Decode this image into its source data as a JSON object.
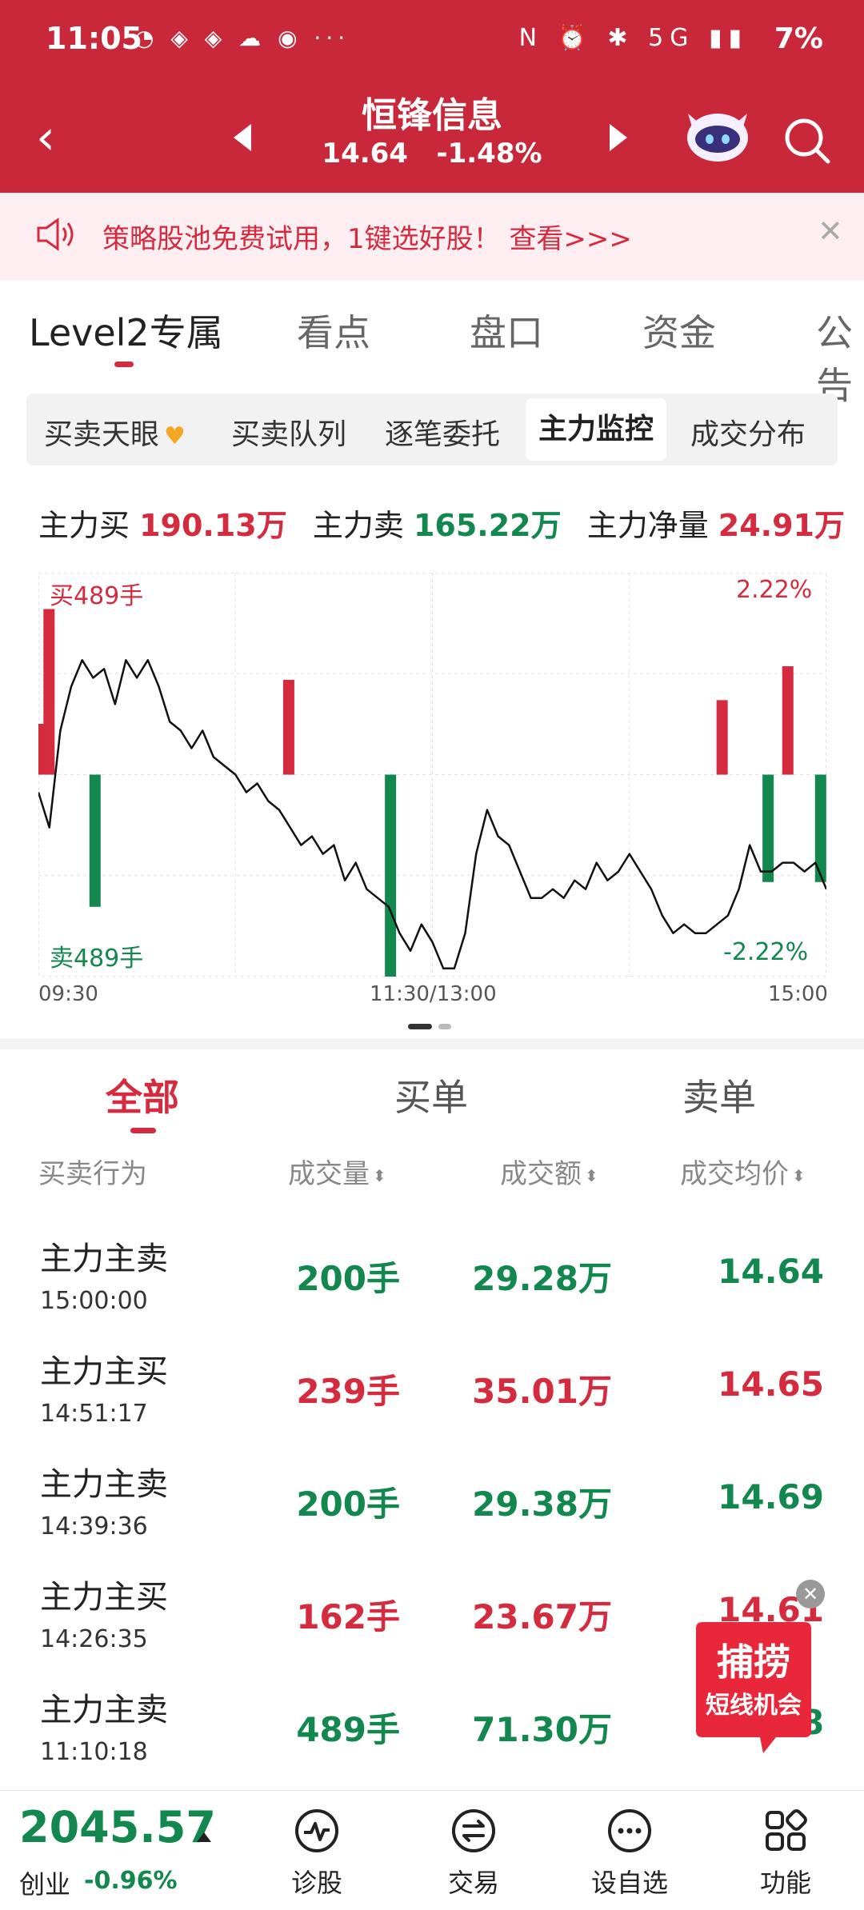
{
  "status_bar": {
    "time": "11:05",
    "notif_icons": "◔ ◈ ◈ ☁ ◉ ···",
    "right_icons": "N ⏰ ✱ 5G ▮▮",
    "battery": "7%"
  },
  "header": {
    "stock_name": "恒锋信息",
    "price": "14.64",
    "change": "-1.48%"
  },
  "promo": {
    "text": "策略股池免费试用，1键选好股！ 查看>>>"
  },
  "tabs": [
    "Level2专属",
    "看点",
    "盘口",
    "资金",
    "公告"
  ],
  "sub_tabs": [
    "买卖天眼",
    "买卖队列",
    "逐笔委托",
    "主力监控",
    "成交分布"
  ],
  "summary": {
    "buy_label": "主力买",
    "buy_value": "190.13万",
    "sell_label": "主力卖",
    "sell_value": "165.22万",
    "net_label": "主力净量",
    "net_value": "24.91万"
  },
  "chart_data": {
    "type": "line",
    "buy_max_label": "买489手",
    "sell_max_label": "卖489手",
    "pct_high": "2.22%",
    "pct_low": "-2.22%",
    "ylim_pct": [
      -2.22,
      2.22
    ],
    "x_labels": [
      "09:30",
      "11:30/13:00",
      "15:00"
    ],
    "series": [
      {
        "values": [
          -0.2,
          -0.6,
          0.5,
          1.0,
          1.3,
          1.1,
          1.2,
          0.8,
          1.3,
          1.1,
          1.3,
          1.0,
          0.6,
          0.5,
          0.3,
          0.5,
          0.2,
          0.1,
          0.0,
          -0.2,
          -0.1,
          -0.3,
          -0.4,
          -0.6,
          -0.8,
          -0.7,
          -0.9,
          -0.8,
          -1.2,
          -1.0,
          -1.3,
          -1.4,
          -1.5,
          -1.8,
          -2.0,
          -1.7,
          -1.9,
          -2.2,
          -2.2,
          -1.8,
          -0.9,
          -0.4,
          -0.7,
          -0.8,
          -1.1,
          -1.4,
          -1.4,
          -1.3,
          -1.4,
          -1.2,
          -1.3,
          -1.0,
          -1.2,
          -1.1,
          -0.9,
          -1.1,
          -1.3,
          -1.6,
          -1.8,
          -1.7,
          -1.8,
          -1.8,
          -1.7,
          -1.6,
          -1.3,
          -0.8,
          -1.1,
          -1.1,
          -1.0,
          -1.0,
          -1.1,
          -1.0,
          -1.3
        ]
      }
    ],
    "buy_bars": [
      {
        "t": 0.3,
        "hands": 150
      },
      {
        "t": 3,
        "hands": 489
      },
      {
        "t": 76,
        "hands": 280
      },
      {
        "t": 208,
        "hands": 220
      },
      {
        "t": 228,
        "hands": 320
      }
    ],
    "sell_bars": [
      {
        "t": 17,
        "hands": 320
      },
      {
        "t": 107,
        "hands": 489
      },
      {
        "t": 222,
        "hands": 260
      },
      {
        "t": 238,
        "hands": 260
      }
    ],
    "x_range": [
      0,
      240
    ]
  },
  "flow_tabs": [
    "全部",
    "买单",
    "卖单"
  ],
  "columns": [
    "买卖行为",
    "成交量",
    "成交额",
    "成交均价"
  ],
  "rows": [
    {
      "action": "主力主卖",
      "time": "15:00:00",
      "volume": "200手",
      "amount": "29.28万",
      "avg_price": "14.64",
      "side": "sell"
    },
    {
      "action": "主力主买",
      "time": "14:51:17",
      "volume": "239手",
      "amount": "35.01万",
      "avg_price": "14.65",
      "side": "buy"
    },
    {
      "action": "主力主卖",
      "time": "14:39:36",
      "volume": "200手",
      "amount": "29.38万",
      "avg_price": "14.69",
      "side": "sell"
    },
    {
      "action": "主力主买",
      "time": "14:26:35",
      "volume": "162手",
      "amount": "23.67万",
      "avg_price": "14.61",
      "side": "buy"
    },
    {
      "action": "主力主卖",
      "time": "11:10:18",
      "volume": "489手",
      "amount": "71.30万",
      "avg_price": "14.58",
      "side": "sell"
    }
  ],
  "float_ad": {
    "line1": "捕捞",
    "line2": "短线机会"
  },
  "bottom": {
    "index_value": "2045.57",
    "index_name": "创业",
    "index_change": "-0.96%",
    "nav": [
      "诊股",
      "交易",
      "设自选",
      "功能"
    ]
  },
  "colors": {
    "header": "#c8283a",
    "up": "#d52b3f",
    "down": "#12874e"
  }
}
